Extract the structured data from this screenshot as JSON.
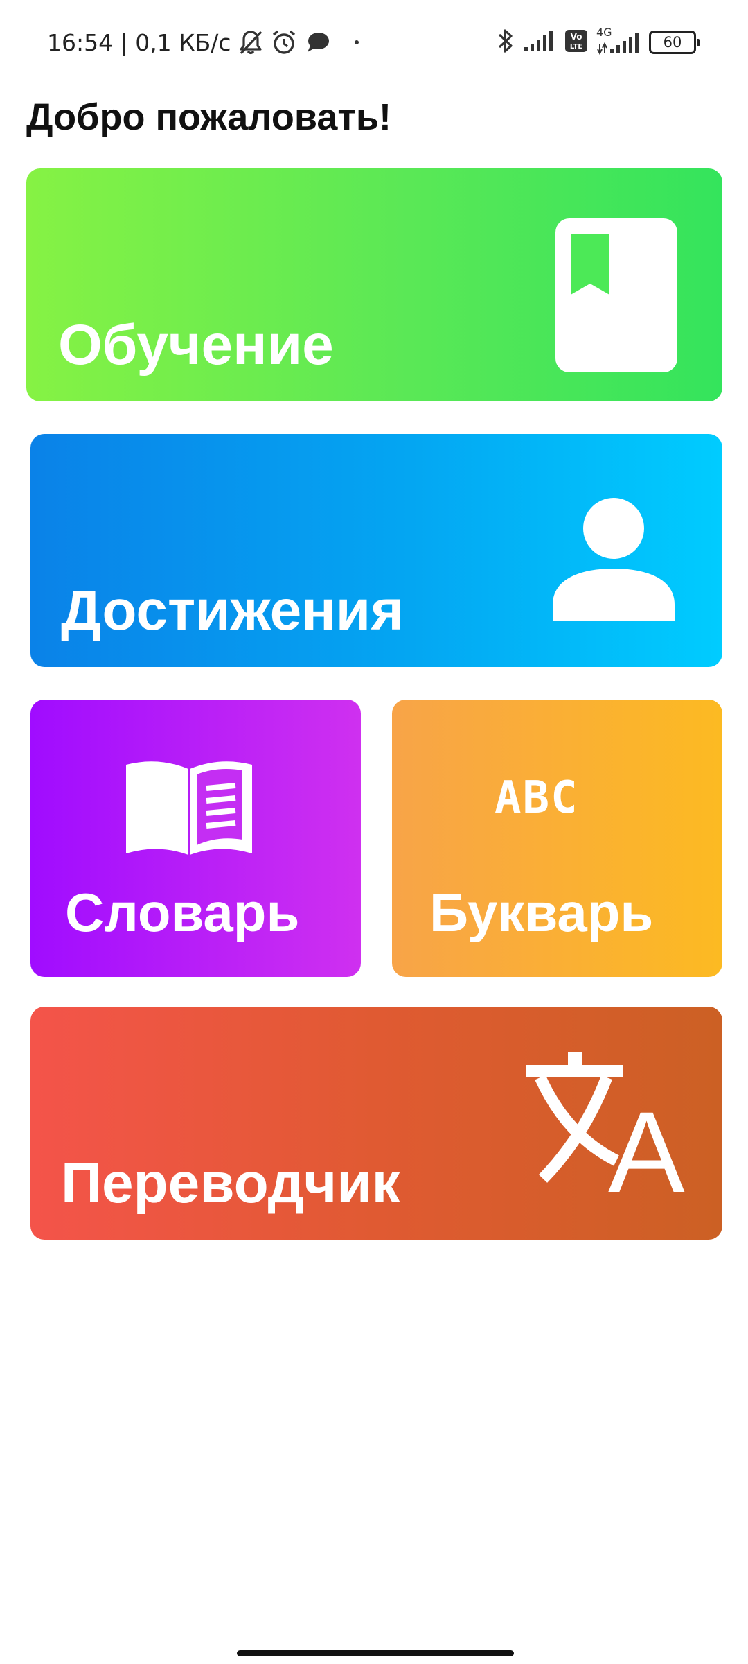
{
  "status_bar": {
    "time_and_speed": "16:54 | 0,1 КБ/с",
    "volte_label": "Vo\nLTE",
    "network_type": "4G",
    "battery_level": "60",
    "icons": [
      "bell-off-icon",
      "alarm-icon",
      "chat-bubble-icon",
      "dot-icon",
      "bluetooth-icon",
      "signal-icon",
      "volte-icon",
      "signal-4g-icon",
      "battery-icon"
    ]
  },
  "header": {
    "title": "Добро пожаловать!"
  },
  "menu": {
    "learning": {
      "label": "Обучение",
      "icon": "book-bookmark-icon"
    },
    "achievements": {
      "label": "Достижения",
      "icon": "person-icon"
    },
    "dictionary": {
      "label": "Словарь",
      "icon": "open-book-icon"
    },
    "primer": {
      "label": "Букварь",
      "icon": "abc-icon",
      "icon_text": "ABC"
    },
    "translator": {
      "label": "Переводчик",
      "icon": "translate-icon",
      "icon_text": "A"
    }
  },
  "colors": {
    "learning_gradient": [
      "#86f244",
      "#34e45c"
    ],
    "achievements_gradient": [
      "#0a82e8",
      "#00ccff"
    ],
    "dictionary_gradient": [
      "#a00cff",
      "#cf30f0"
    ],
    "primer_gradient": [
      "#f8a448",
      "#fcba22"
    ],
    "translator_gradient": [
      "#f4544a",
      "#cc6024"
    ]
  }
}
